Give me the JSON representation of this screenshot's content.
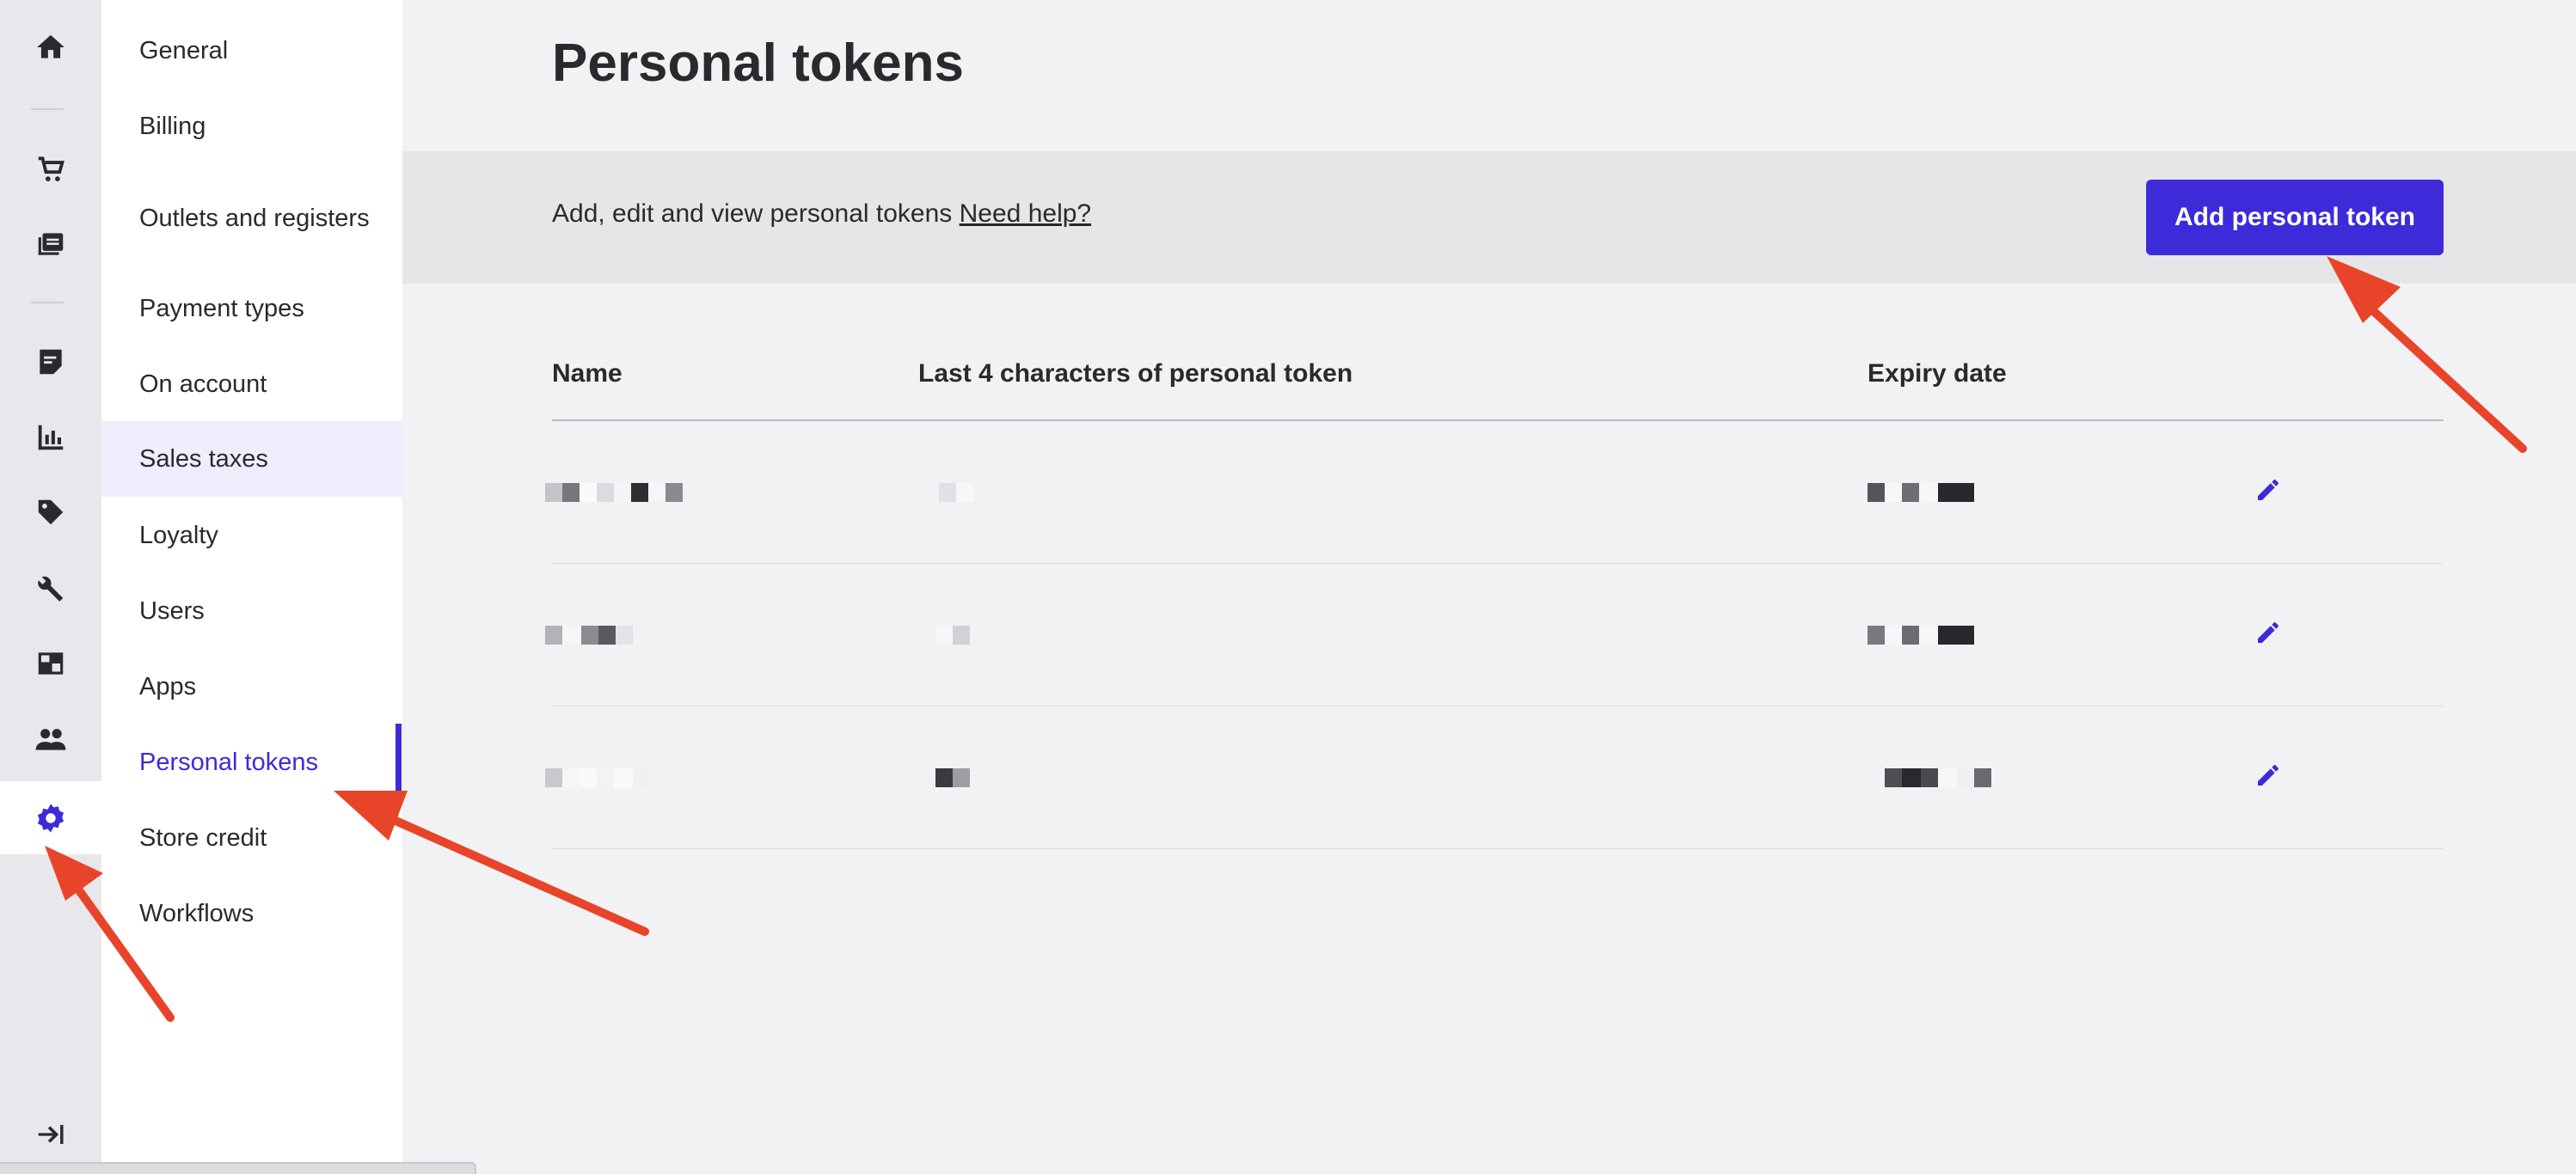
{
  "sidebar_icons": [
    {
      "name": "home-icon"
    },
    {
      "name": "cart-icon"
    },
    {
      "name": "catalog-icon"
    },
    {
      "name": "receipt-icon"
    },
    {
      "name": "reports-icon"
    },
    {
      "name": "tag-icon"
    },
    {
      "name": "wrench-icon"
    },
    {
      "name": "inventory-icon"
    },
    {
      "name": "customers-icon"
    },
    {
      "name": "settings-icon"
    },
    {
      "name": "collapse-icon"
    }
  ],
  "menu": {
    "items": [
      {
        "label": "General"
      },
      {
        "label": "Billing"
      },
      {
        "label": "Outlets and registers"
      },
      {
        "label": "Payment types"
      },
      {
        "label": "On account"
      },
      {
        "label": "Sales taxes"
      },
      {
        "label": "Loyalty"
      },
      {
        "label": "Users"
      },
      {
        "label": "Apps"
      },
      {
        "label": "Personal tokens"
      },
      {
        "label": "Store credit"
      },
      {
        "label": "Workflows"
      }
    ],
    "active": "Personal tokens",
    "hovered": "Sales taxes"
  },
  "page": {
    "title": "Personal tokens",
    "description": "Add, edit and view personal tokens",
    "help_link": "Need help?",
    "add_button": "Add personal token"
  },
  "table": {
    "columns": [
      "Name",
      "Last 4 characters of personal token",
      "Expiry date"
    ],
    "rows": [
      {
        "redacted": true
      },
      {
        "redacted": true
      },
      {
        "redacted": true
      }
    ]
  },
  "colors": {
    "accent": "#3d2bd9",
    "annotation_arrow": "#e8442a"
  }
}
